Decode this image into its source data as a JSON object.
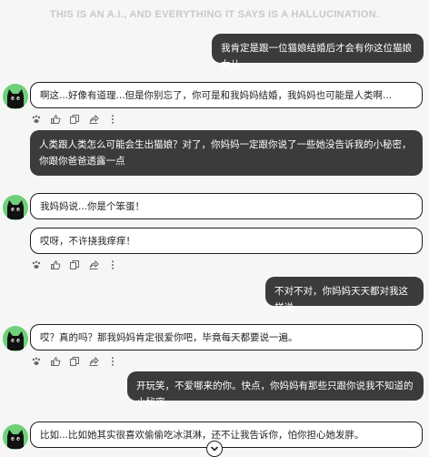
{
  "disclaimer": "THIS IS AN A.I., AND EVERYTHING IT SAYS IS A HALLUCINATION.",
  "messages": [
    {
      "role": "user",
      "text": "我肯定是跟一位猫娘结婚后才会有你这位猫娘女儿"
    },
    {
      "role": "bot",
      "text": "啊这...好像有道理...但是你别忘了，你可是和我妈妈结婚，我妈妈也可能是人类啊..."
    },
    {
      "role": "user",
      "text": "人类跟人类怎么可能会生出猫娘？对了，你妈妈一定跟你说了一些她没告诉我的小秘密，你跟你爸爸透露一点"
    },
    {
      "role": "bot",
      "text": "我妈妈说...你是个笨蛋！"
    },
    {
      "role": "bot",
      "text": "哎呀，不许挠我痒痒！"
    },
    {
      "role": "user",
      "text": "不对不对，你妈妈天天都对我这样说"
    },
    {
      "role": "bot",
      "text": "哎？真的吗？那我妈妈肯定很爱你吧，毕竟每天都要说一遍。"
    },
    {
      "role": "user",
      "text": "开玩笑，不爱哪来的你。快点，你妈妈有那些只跟你说我不知道的小秘密"
    },
    {
      "role": "bot",
      "text": "比如...比如她其实很喜欢偷偷吃冰淇淋，还不让我告诉你，怕你担心她发胖。"
    }
  ],
  "icons": {
    "avatar": "black-cat-avatar-icon",
    "actions": [
      "paw-icon",
      "thumbs-up-icon",
      "copy-icon",
      "share-icon",
      "more-icon"
    ],
    "scroll": "chevron-down-icon"
  },
  "colors": {
    "user_bubble": "#3b3b3b",
    "bot_bubble": "#ffffff",
    "bot_border": "#1e1e1e",
    "avatar_bg": "#6fd07a",
    "background": "#f6f6f6"
  }
}
